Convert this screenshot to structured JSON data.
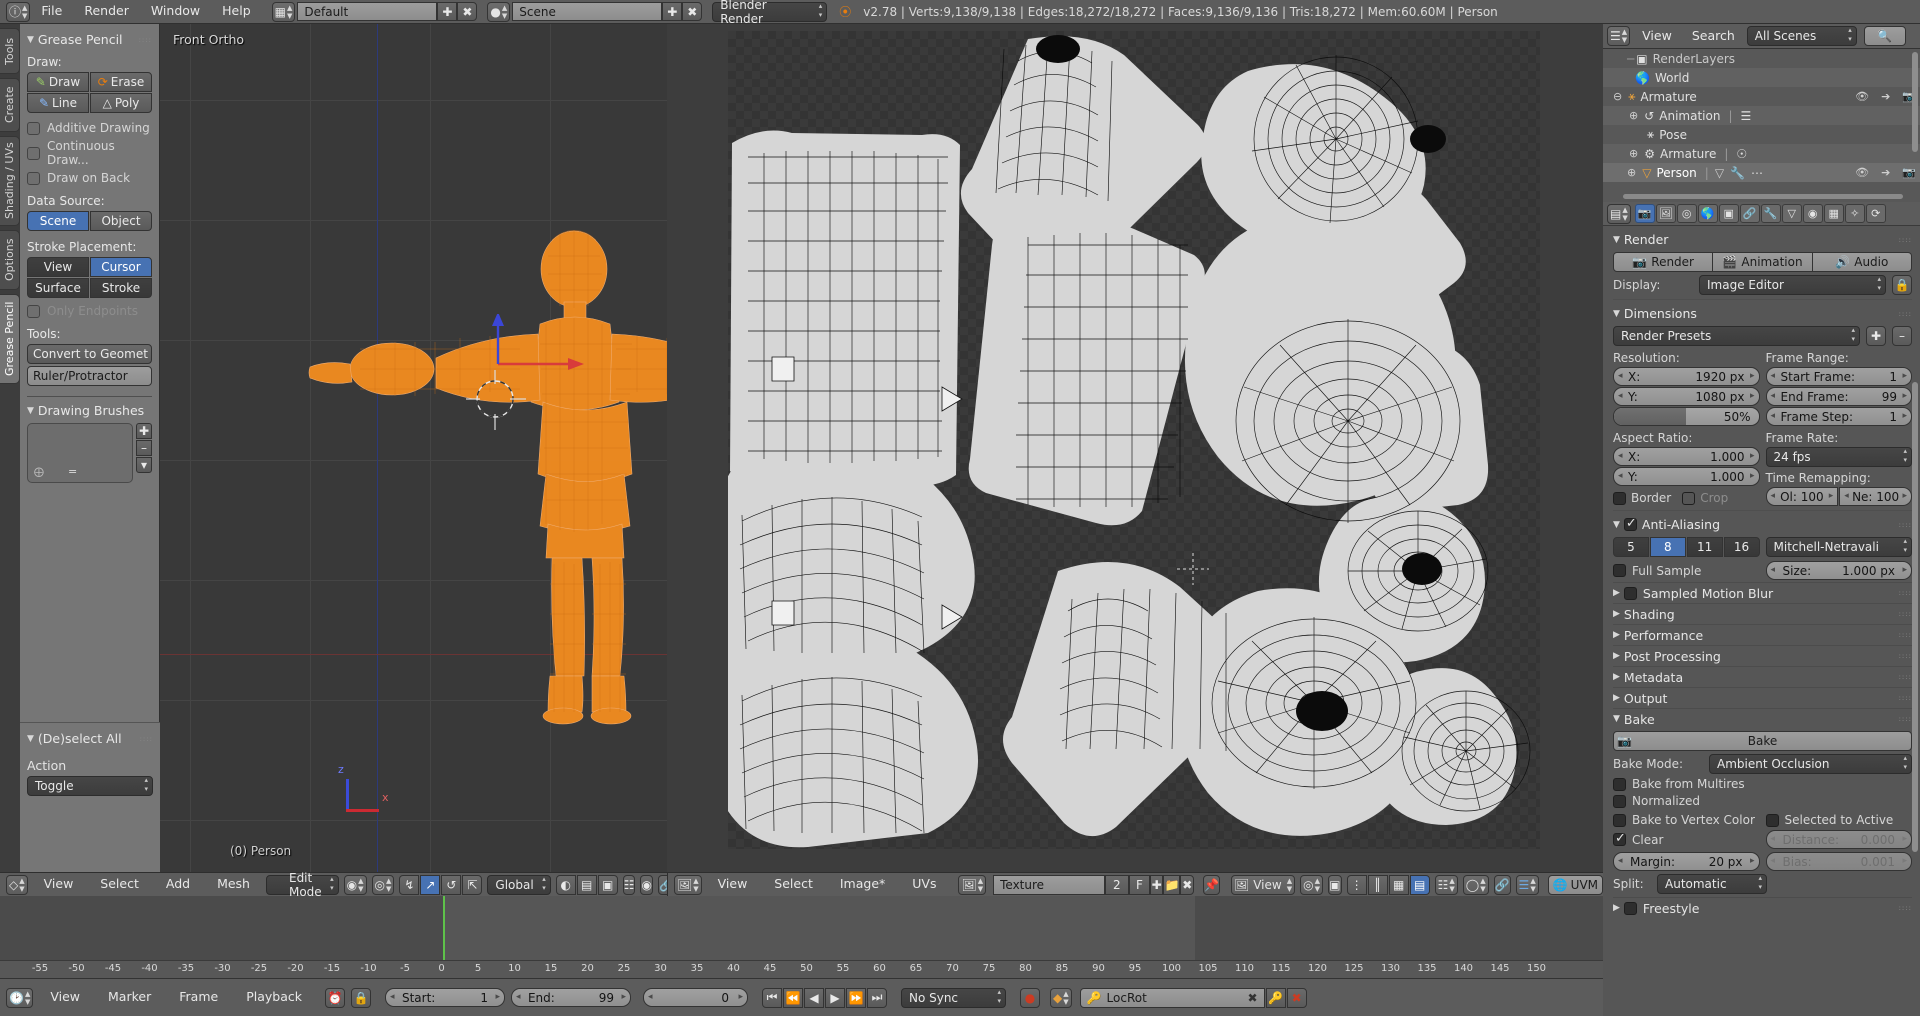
{
  "topbar": {
    "menus": [
      "File",
      "Render",
      "Window",
      "Help"
    ],
    "screen_layout": "Default",
    "scene": "Scene",
    "engine": "Blender Render",
    "status": "v2.78 | Verts:9,138/9,138 | Edges:18,272/18,272 | Faces:9,136/9,136 | Tris:18,272 | Mem:60.60M | Person"
  },
  "tool_tabs": [
    "Tools",
    "Create",
    "Shading / UVs",
    "Options",
    "Grease Pencil"
  ],
  "tool_tab_active": "Grease Pencil",
  "grease_pencil": {
    "panel_title": "Grease Pencil",
    "draw_label": "Draw:",
    "draw_buttons": [
      "Draw",
      "Erase",
      "Line",
      "Poly"
    ],
    "toggles": [
      {
        "label": "Additive Drawing",
        "checked": false
      },
      {
        "label": "Continuous Draw...",
        "checked": false
      },
      {
        "label": "Draw on Back",
        "checked": false
      }
    ],
    "data_source_label": "Data Source:",
    "data_source": [
      "Scene",
      "Object"
    ],
    "data_source_active": "Scene",
    "stroke_placement_label": "Stroke Placement:",
    "stroke_placement": [
      "View",
      "Cursor",
      "Surface",
      "Stroke"
    ],
    "stroke_placement_active": "Cursor",
    "only_endpoints": {
      "label": "Only Endpoints",
      "checked": false,
      "disabled": true
    },
    "tools_label": "Tools:",
    "tools_buttons": [
      "Convert to Geomet",
      "Ruler/Protractor"
    ],
    "drawing_brushes_title": "Drawing Brushes"
  },
  "deselect_panel": {
    "title": "(De)select All",
    "action_label": "Action",
    "action_value": "Toggle"
  },
  "viewport3d": {
    "view_name": "Front Ortho",
    "object_name": "(0) Person",
    "axis_z": "z",
    "axis_x": "x"
  },
  "outliner": {
    "menus": [
      "View",
      "Search"
    ],
    "scope": "All Scenes",
    "items": [
      {
        "label": "RenderLayers",
        "depth": 1,
        "icon": "renderlayers-icon",
        "clipped": true
      },
      {
        "label": "World",
        "depth": 2,
        "icon": "world-icon"
      },
      {
        "label": "Armature",
        "depth": 1,
        "icon": "armature-icon",
        "expander": "minus"
      },
      {
        "label": "Animation",
        "depth": 3,
        "icon": "animation-icon",
        "expander": "plus"
      },
      {
        "label": "Pose",
        "depth": 3,
        "icon": "pose-icon"
      },
      {
        "label": "Armature",
        "depth": 3,
        "icon": "armature-data-icon",
        "expander": "plus"
      },
      {
        "label": "Person",
        "depth": 2,
        "icon": "mesh-icon",
        "expander": "plus",
        "selected": true
      }
    ]
  },
  "properties": {
    "render": {
      "title": "Render",
      "buttons": [
        "Render",
        "Animation",
        "Audio"
      ],
      "display_label": "Display:",
      "display_value": "Image Editor"
    },
    "dimensions": {
      "title": "Dimensions",
      "preset": "Render Presets",
      "resolution_label": "Resolution:",
      "res_x_label": "X:",
      "res_x_value": "1920 px",
      "res_y_label": "Y:",
      "res_y_value": "1080 px",
      "res_percent": "50%",
      "frame_range_label": "Frame Range:",
      "start_frame_label": "Start Frame:",
      "start_frame_value": "1",
      "end_frame_label": "End Frame:",
      "end_frame_value": "99",
      "frame_step_label": "Frame Step:",
      "frame_step_value": "1",
      "aspect_label": "Aspect Ratio:",
      "aspect_x_label": "X:",
      "aspect_x_value": "1.000",
      "aspect_y_label": "Y:",
      "aspect_y_value": "1.000",
      "frame_rate_label": "Frame Rate:",
      "frame_rate_value": "24 fps",
      "time_remap_label": "Time Remapping:",
      "old_label": "Ol: 100",
      "new_label": "Ne: 100",
      "border_label": "Border",
      "border_checked": false,
      "crop_label": "Crop",
      "crop_checked": false,
      "crop_disabled": true
    },
    "antialiasing": {
      "title": "Anti-Aliasing",
      "enabled": true,
      "samples": [
        "5",
        "8",
        "11",
        "16"
      ],
      "samples_active": "8",
      "filter": "Mitchell-Netravali",
      "full_sample_label": "Full Sample",
      "full_sample_checked": false,
      "size_label": "Size:",
      "size_value": "1.000 px"
    },
    "collapsed": [
      {
        "title": "Sampled Motion Blur",
        "has_checkbox": true
      },
      {
        "title": "Shading"
      },
      {
        "title": "Performance"
      },
      {
        "title": "Post Processing"
      },
      {
        "title": "Metadata"
      },
      {
        "title": "Output"
      }
    ],
    "bake": {
      "title": "Bake",
      "bake_button": "Bake",
      "mode_label": "Bake Mode:",
      "mode_value": "Ambient Occlusion",
      "from_multires_label": "Bake from Multires",
      "from_multires_checked": false,
      "normalized_label": "Normalized",
      "normalized_checked": false,
      "vertex_color_label": "Bake to Vertex Color",
      "vertex_color_checked": false,
      "selected_to_active_label": "Selected to Active",
      "selected_to_active_checked": false,
      "clear_label": "Clear",
      "clear_checked": true,
      "distance_label": "Distance:",
      "distance_value": "0.000",
      "margin_label": "Margin:",
      "margin_value": "20 px",
      "bias_label": "Bias:",
      "bias_value": "0.001",
      "split_label": "Split:",
      "split_value": "Automatic"
    },
    "freestyle": {
      "title": "Freestyle",
      "checked": false
    }
  },
  "view3d_header": {
    "menus": [
      "View",
      "Select",
      "Add",
      "Mesh"
    ],
    "mode": "Edit Mode",
    "orientation": "Global"
  },
  "uv_header": {
    "menus": [
      "View",
      "Select",
      "Image*",
      "UVs"
    ],
    "image_name": "Texture",
    "users": "2",
    "fake_user": "F",
    "pivot_label": "View"
  },
  "uv_footer_label": "UVM",
  "timeline": {
    "menus": [
      "View",
      "Marker",
      "Frame",
      "Playback"
    ],
    "start_label": "Start:",
    "start_value": "1",
    "end_label": "End:",
    "end_value": "99",
    "current_frame": "0",
    "sync_mode": "No Sync",
    "keying_set": "LocRot",
    "ticks": [
      "-55",
      "-50",
      "-45",
      "-40",
      "-35",
      "-30",
      "-25",
      "-20",
      "-15",
      "-10",
      "-5",
      "0",
      "5",
      "10",
      "15",
      "20",
      "25",
      "30",
      "35",
      "40",
      "45",
      "50",
      "55",
      "60",
      "65",
      "70",
      "75",
      "80",
      "85",
      "90",
      "95",
      "100",
      "105",
      "110",
      "115",
      "120",
      "125",
      "130",
      "135",
      "140",
      "145",
      "150"
    ]
  }
}
